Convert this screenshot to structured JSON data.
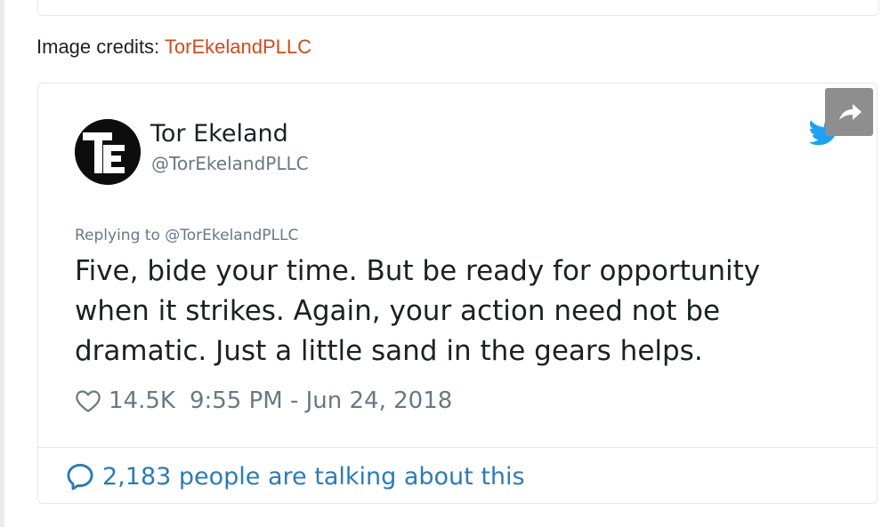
{
  "credits": {
    "label": "Image credits: ",
    "link": "TorEkelandPLLC"
  },
  "tweet": {
    "display_name": "Tor Ekeland",
    "handle": "@TorEkelandPLLC",
    "replying_to": "Replying to @TorEkelandPLLC",
    "text": "Five, bide your time. But be ready for opportunity when it strikes. Again, your action need not be dramatic. Just a little sand in the gears helps.",
    "likes": "14.5K",
    "timestamp": "9:55 PM - Jun 24, 2018",
    "talking": "2,183 people are talking about this"
  },
  "icons": {
    "avatar": "tor-ekeland-logo",
    "twitter": "twitter-bird-icon",
    "share": "share-arrow-icon",
    "like": "heart-icon",
    "reply": "speech-bubble-icon"
  },
  "colors": {
    "link_orange": "#d04a1c",
    "twitter_blue": "#1da1f2",
    "link_blue": "#2b7bb9",
    "muted_gray": "#697882",
    "text_dark": "#1c2022"
  }
}
